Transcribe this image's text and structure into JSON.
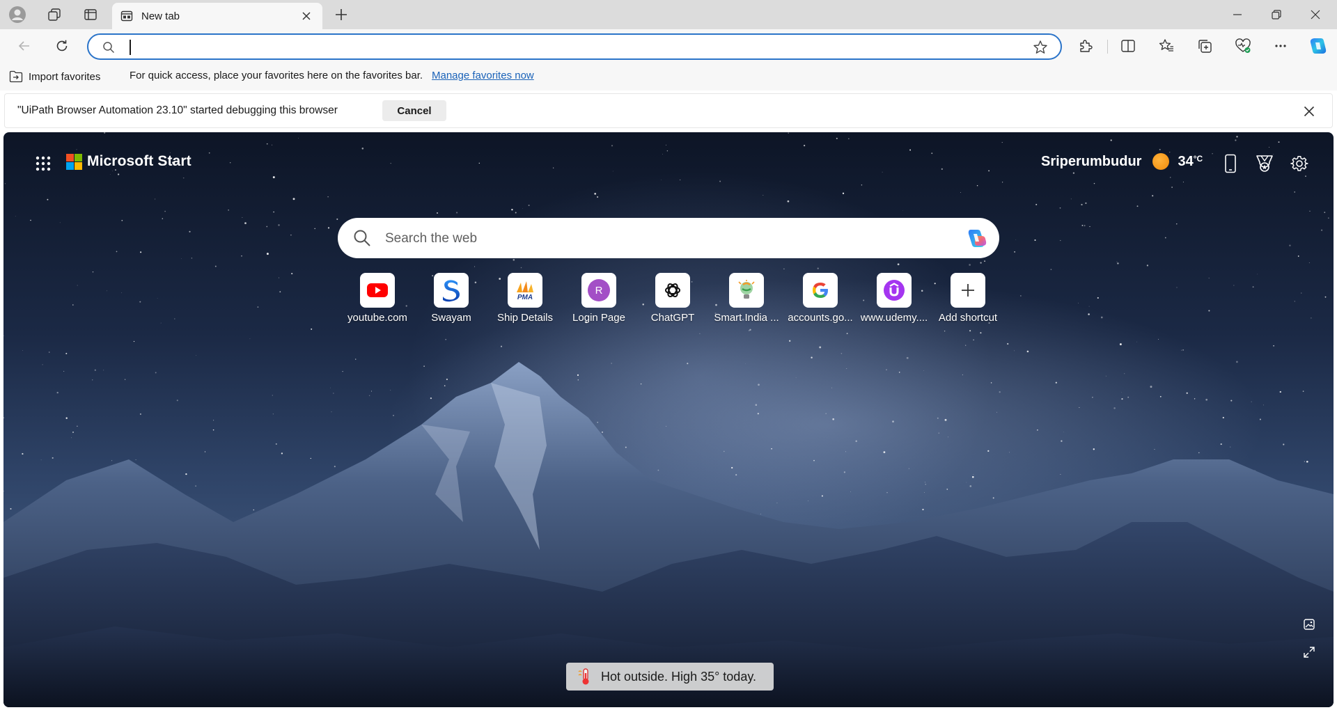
{
  "window": {
    "tab_title": "New tab"
  },
  "address_bar": {
    "value": "",
    "placeholder": ""
  },
  "favorites_bar": {
    "import_label": "Import favorites",
    "message": "For quick access, place your favorites here on the favorites bar.",
    "manage_link": "Manage favorites now"
  },
  "banner": {
    "message": "\"UiPath Browser Automation 23.10\" started debugging this browser",
    "cancel_label": "Cancel"
  },
  "ntp": {
    "brand": "Microsoft Start",
    "weather": {
      "location": "Sriperumbudur",
      "temperature": "34",
      "unit": "°C"
    },
    "search_placeholder": "Search the web",
    "shortcuts": [
      {
        "label": "youtube.com",
        "icon": "youtube-icon"
      },
      {
        "label": "Swayam",
        "icon": "swayam-icon"
      },
      {
        "label": "Ship Details",
        "icon": "pma-icon"
      },
      {
        "label": "Login Page",
        "icon": "letter-r-icon",
        "letter": "R"
      },
      {
        "label": "ChatGPT",
        "icon": "chatgpt-icon"
      },
      {
        "label": "Smart India ...",
        "icon": "smart-india-icon"
      },
      {
        "label": "accounts.go...",
        "icon": "google-icon"
      },
      {
        "label": "www.udemy....",
        "icon": "udemy-icon"
      },
      {
        "label": "Add shortcut",
        "icon": "plus-icon"
      }
    ],
    "toast": "Hot outside. High 35° today."
  },
  "colors": {
    "accent": "#2b74c9",
    "link": "#1a62b8",
    "microsoft_red": "#f25022",
    "microsoft_green": "#7fba00",
    "microsoft_blue": "#00a4ef",
    "microsoft_yellow": "#ffb900"
  }
}
